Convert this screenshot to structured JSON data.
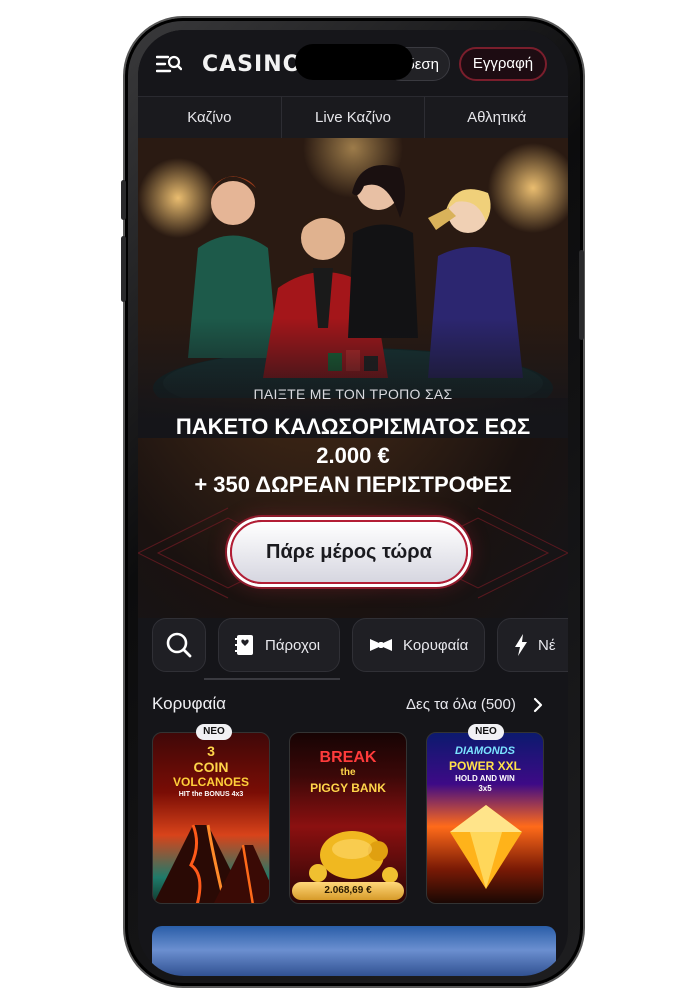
{
  "header": {
    "logo": "CASINO",
    "login_label": "δεση",
    "register_label": "Εγγραφή"
  },
  "nav": {
    "tabs": [
      {
        "label": "Καζίνο"
      },
      {
        "label": "Live Καζίνο"
      },
      {
        "label": "Αθλητικά"
      }
    ]
  },
  "hero": {
    "subtitle": "ΠΑΙΞΤΕ ΜΕ ΤΟΝ ΤΡΟΠΟ ΣΑΣ",
    "title_line1": "ΠΑΚΕΤΟ ΚΑΛΩΣΟΡΙΣΜΑΤΟΣ ΕΩΣ",
    "title_line2": "2.000 €",
    "title_line3": "+ 350 ΔΩΡΕΑΝ ΠΕΡΙΣΤΡΟΦΕΣ",
    "cta_label": "Πάρε μέρος τώρα"
  },
  "categories": [
    {
      "label": "Πάροχοι",
      "icon": "provider-book-icon"
    },
    {
      "label": "Κορυφαία",
      "icon": "bowtie-icon"
    },
    {
      "label": "Νέ",
      "icon": "lightning-icon"
    }
  ],
  "section": {
    "title": "Κορυφαία",
    "see_all": "Δες τα όλα (500)"
  },
  "games": [
    {
      "badge": "ΝΕΟ",
      "line1": "3",
      "line2": "COIN",
      "line3": "VOLCANOES",
      "line4": "HIT the BONUS 4x3"
    },
    {
      "line1": "BREAK",
      "line2": "the",
      "line3": "PIGGY BANK",
      "price": "2.068,69 €"
    },
    {
      "badge": "ΝΕΟ",
      "line1": "DIAMONDS",
      "line2": "POWER XXL",
      "line3": "HOLD AND WIN",
      "line4": "3x5"
    }
  ]
}
